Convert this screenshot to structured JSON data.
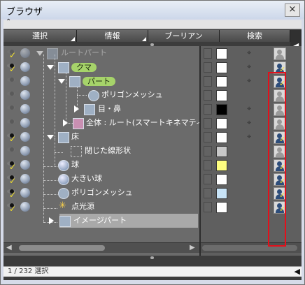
{
  "window": {
    "title": "ブラウザ",
    "close_label": "×"
  },
  "sortbar": {
    "chevron": "⌃"
  },
  "tabs": [
    {
      "label": "選択",
      "has_menu": true
    },
    {
      "label": "情報",
      "has_menu": true
    },
    {
      "label": "ブーリアン",
      "has_menu": false
    },
    {
      "label": "検索",
      "has_menu": false
    }
  ],
  "tab_scroll_arrow": "◀",
  "tree": [
    {
      "label": "ルートパート",
      "visible": false,
      "checked": true,
      "dim": true
    },
    {
      "label": "クマ",
      "pill": true,
      "visible": true,
      "checked": true
    },
    {
      "label": "パート",
      "pill": true,
      "visible": false,
      "checked": false
    },
    {
      "label": "ポリゴンメッシュ",
      "visible": false,
      "checked": false
    },
    {
      "label": "目・鼻",
      "visible": false,
      "checked": false
    },
    {
      "label": "全体 : ルート(スマートキネマティクス)",
      "visible": false,
      "checked": false
    },
    {
      "label": "床",
      "visible": true,
      "checked": true
    },
    {
      "label": "閉じた線形状",
      "visible": false,
      "checked": false
    },
    {
      "label": "球",
      "visible": true,
      "checked": true
    },
    {
      "label": "大きい球",
      "visible": true,
      "checked": true
    },
    {
      "label": "ポリゴンメッシュ",
      "visible": true,
      "checked": true
    },
    {
      "label": "点光源",
      "visible": true,
      "checked": true
    },
    {
      "label": "イメージパート",
      "selected": true
    }
  ],
  "colors": {
    "swatches": [
      "#ffffff",
      "#ffffff",
      "#ffffff",
      "#ffffff",
      "#000000",
      "#ffffff",
      "#ffffff",
      "#c8c8c8",
      "#ffff80",
      "#ffffff",
      "#c8e4f8",
      "#ffffff"
    ],
    "accent": "#a6d36a",
    "highlight_box": "#e3101b"
  },
  "person_states": [
    "off",
    "on",
    "on",
    "off",
    "off",
    "off",
    "on",
    "off",
    "on",
    "on",
    "on",
    "on"
  ],
  "status": {
    "selection": "1 / 232 選択",
    "arrow": "◀"
  }
}
